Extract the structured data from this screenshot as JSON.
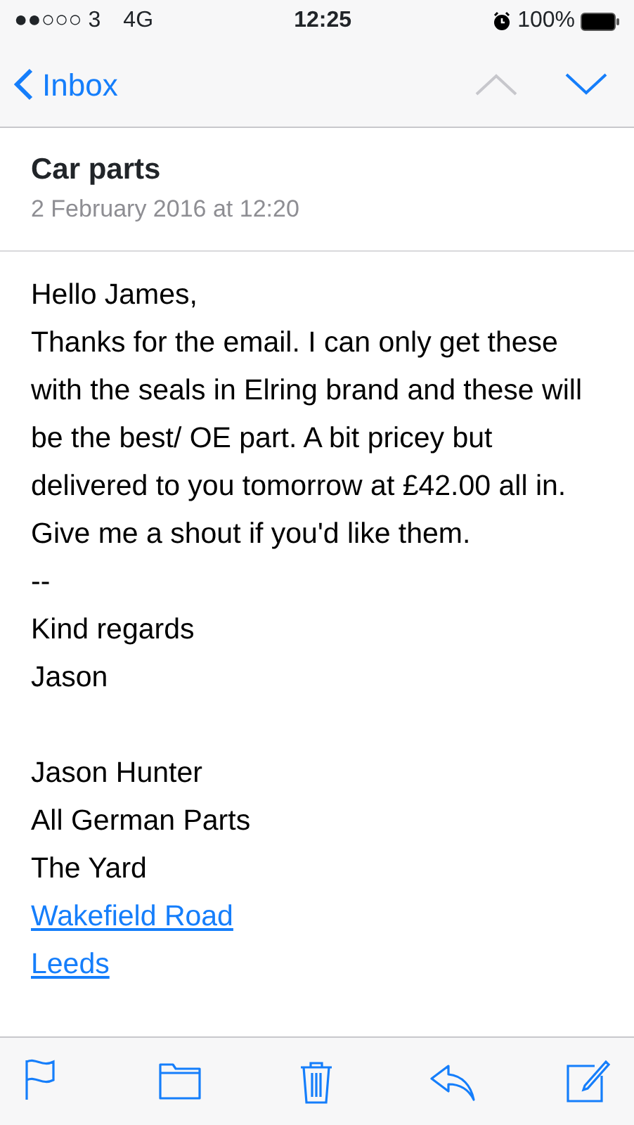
{
  "status_bar": {
    "carrier": "●●○○○ 3",
    "network": "4G",
    "time": "12:25",
    "battery": "100%"
  },
  "nav": {
    "back": "Inbox",
    "previous_disabled": true,
    "next_disabled": false
  },
  "message": {
    "subject": "Car parts",
    "date": "2 February 2016 at 12:20"
  },
  "body_blocks": [
    [
      {
        "kind": "text",
        "text": "Hello James,"
      },
      {
        "kind": "text",
        "text": "Thanks for the email. I can only get these with the seals in Elring brand and these will be the best/ OE part. A bit pricey but delivered to you tomorrow at £42.00 all in. Give me a shout if you'd like them."
      },
      {
        "kind": "text",
        "text": "--"
      },
      {
        "kind": "text",
        "text": "Kind regards"
      },
      {
        "kind": "text",
        "text": "Jason"
      }
    ],
    [
      {
        "kind": "text",
        "text": "Jason Hunter"
      },
      {
        "kind": "text",
        "text": "All German Parts"
      },
      {
        "kind": "text",
        "text": "The Yard"
      },
      {
        "kind": "link",
        "text": "Wakefield Road"
      },
      {
        "kind": "link",
        "text": "Leeds"
      }
    ]
  ],
  "toolbar": [
    {
      "kind": "flag"
    },
    {
      "kind": "folder"
    },
    {
      "kind": "trash"
    },
    {
      "kind": "reply"
    },
    {
      "kind": "compose"
    }
  ]
}
